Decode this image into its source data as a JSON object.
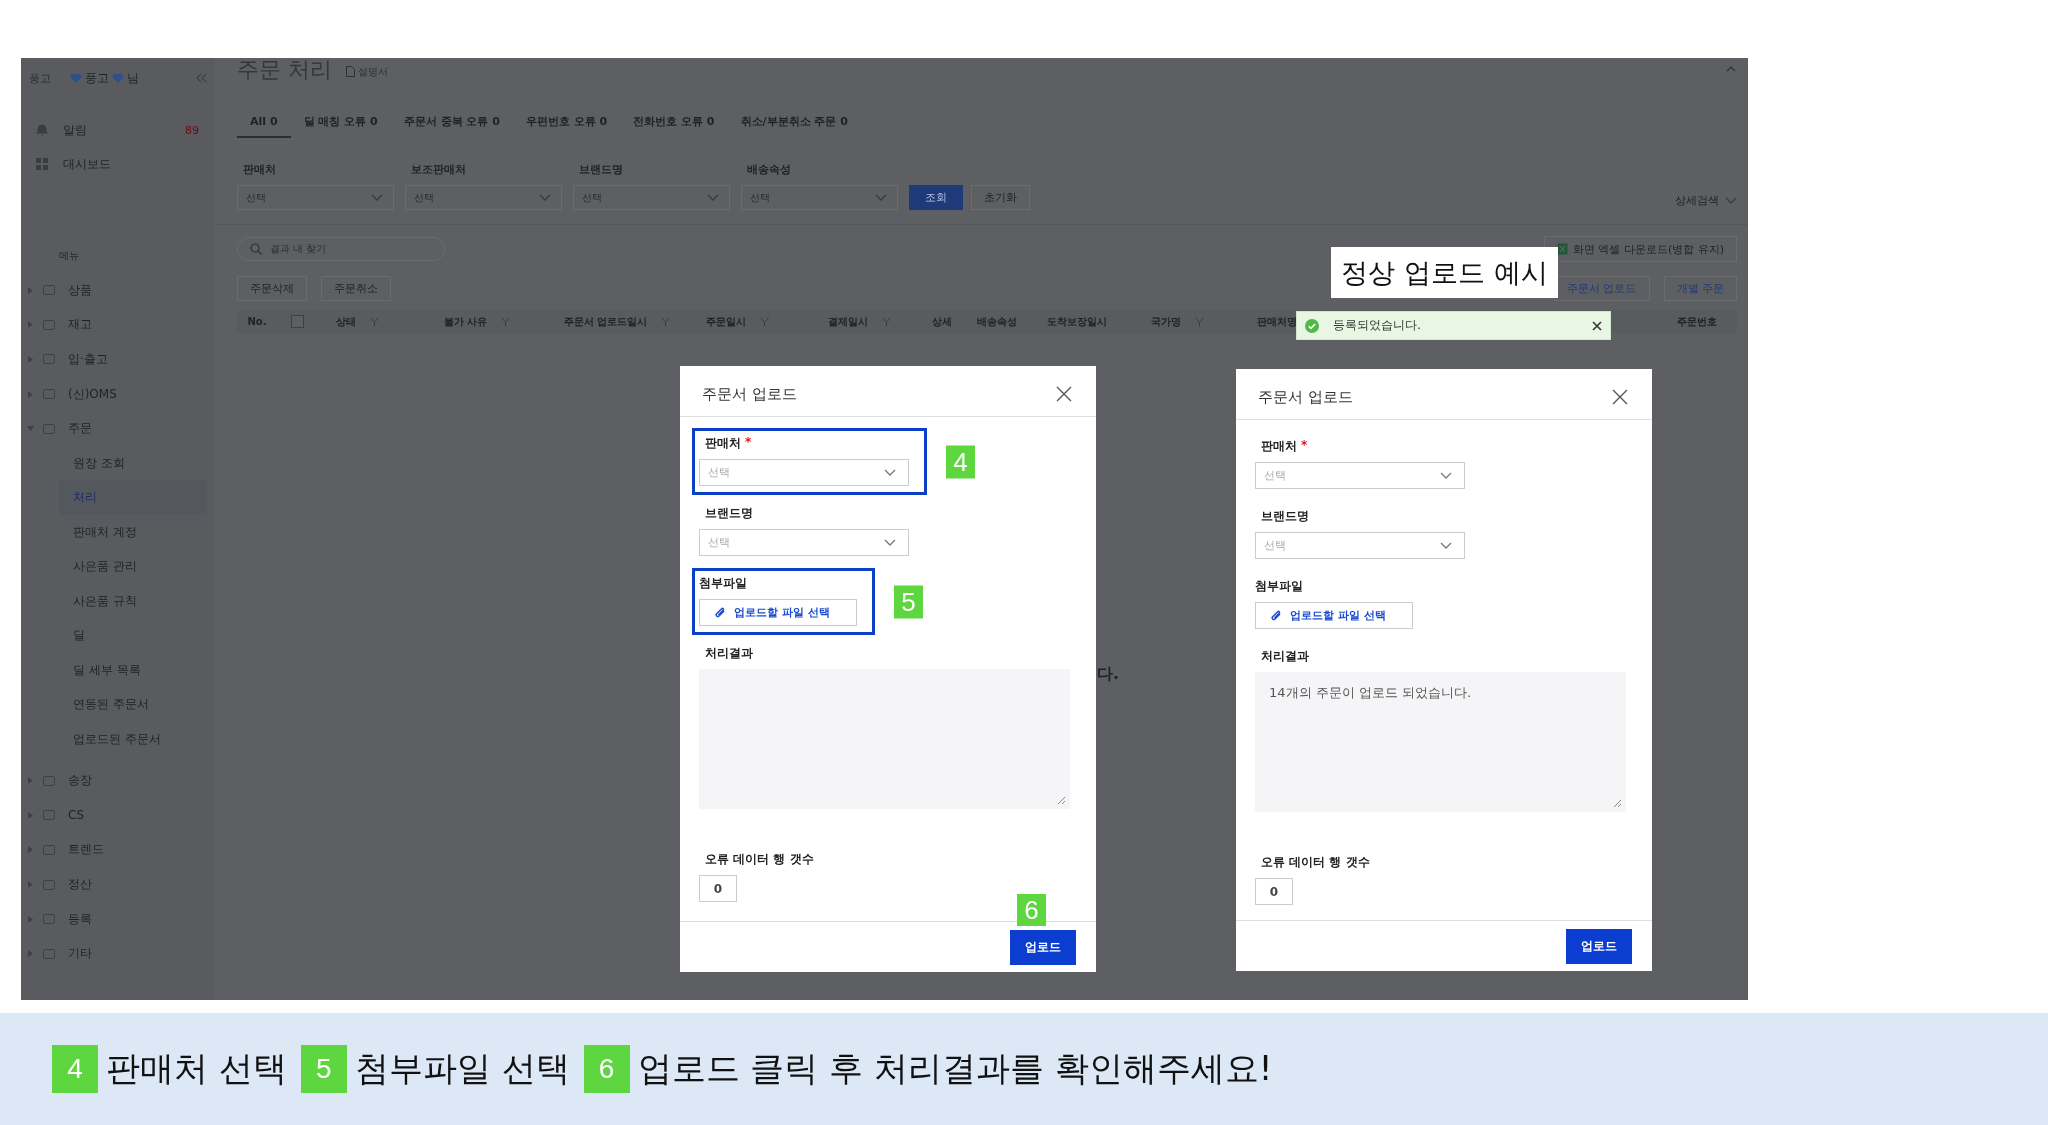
{
  "sidebar": {
    "logo": "풍고",
    "user": {
      "name": "풍고",
      "suffix": "님"
    },
    "top_items": [
      {
        "label": "알림",
        "count": "89"
      },
      {
        "label": "대시보드"
      }
    ],
    "section": "메뉴",
    "menu": [
      {
        "label": "상품",
        "expanded": false
      },
      {
        "label": "재고",
        "expanded": false
      },
      {
        "label": "입·출고",
        "expanded": false
      },
      {
        "label": "(신)OMS",
        "expanded": false
      },
      {
        "label": "주문",
        "expanded": true,
        "children": [
          {
            "label": "원장 조회",
            "selected": false
          },
          {
            "label": "처리",
            "selected": true
          },
          {
            "label": "판매처 계정",
            "selected": false
          },
          {
            "label": "사은품 관리",
            "selected": false
          },
          {
            "label": "사은품 규칙",
            "selected": false
          },
          {
            "label": "딜",
            "selected": false
          },
          {
            "label": "딜 세부 목록",
            "selected": false
          },
          {
            "label": "연동된 주문서",
            "selected": false
          },
          {
            "label": "업로드된 주문서",
            "selected": false
          }
        ]
      },
      {
        "label": "송장",
        "expanded": false
      },
      {
        "label": "CS",
        "expanded": false
      },
      {
        "label": "트렌드",
        "expanded": false
      },
      {
        "label": "정산",
        "expanded": false
      },
      {
        "label": "등록",
        "expanded": false
      },
      {
        "label": "기타",
        "expanded": false
      }
    ]
  },
  "page": {
    "title": "주문 처리",
    "manual_link": "설명서",
    "tabs": [
      {
        "label": "All 0",
        "selected": true
      },
      {
        "label": "딜 매칭 오류 0",
        "selected": false
      },
      {
        "label": "주문서 중복 오류 0",
        "selected": false
      },
      {
        "label": "우편번호 오류 0",
        "selected": false
      },
      {
        "label": "전화번호 오류 0",
        "selected": false
      },
      {
        "label": "취소/부분취소 주문 0",
        "selected": false
      }
    ],
    "filters": [
      {
        "label": "판매처",
        "placeholder": "선택"
      },
      {
        "label": "보조판매처",
        "placeholder": "선택"
      },
      {
        "label": "브랜드명",
        "placeholder": "선택"
      },
      {
        "label": "배송속성",
        "placeholder": "선택"
      }
    ],
    "search_button": "조회",
    "reset_button": "초기화",
    "detail_search": "상세검색",
    "search": {
      "placeholder": "결과 내 찾기"
    },
    "excel_button": "화면 엑셀 다운로드(병합 유지)",
    "action_buttons": [
      "주문삭제",
      "주문취소"
    ],
    "right_buttons": [
      "주문서 업로드",
      "개별 주문"
    ],
    "columns": [
      {
        "kind": "text",
        "label": "No.",
        "filter": false
      },
      {
        "kind": "checkbox",
        "checked": false
      },
      {
        "kind": "text",
        "label": "상태",
        "filter": true
      },
      {
        "kind": "text",
        "label": "불가 사유",
        "filter": true
      },
      {
        "kind": "text",
        "label": "주문서 업로드일시",
        "filter": true
      },
      {
        "kind": "text",
        "label": "주문일시",
        "filter": true
      },
      {
        "kind": "text",
        "label": "결제일시",
        "filter": true
      },
      {
        "kind": "text",
        "label": "상세",
        "filter": false
      },
      {
        "kind": "text",
        "label": "배송속성",
        "filter": false
      },
      {
        "kind": "text",
        "label": "도착보장일시",
        "filter": false
      },
      {
        "kind": "text",
        "label": "국가명",
        "filter": true
      },
      {
        "kind": "text",
        "label": "판매처명",
        "filter": false
      },
      {
        "kind": "text",
        "label": "주문번호",
        "filter": false
      }
    ],
    "empty_message": "다."
  },
  "toast": {
    "caption": "정상 업로드 예시",
    "message": "등록되었습니다."
  },
  "modals": [
    {
      "title": "주문서 업로드",
      "fields": [
        {
          "kind": "select",
          "label": "판매처",
          "required_mark": "*",
          "placeholder": "선택",
          "badge": "4"
        },
        {
          "kind": "select",
          "label": "브랜드명",
          "placeholder": "선택"
        },
        {
          "kind": "file",
          "label": "첨부파일",
          "button": "업로드할 파일 선택",
          "badge": "5"
        },
        {
          "kind": "textarea",
          "label": "처리결과"
        },
        {
          "kind": "number",
          "label": "오류 데이터 행 갯수",
          "value": "0"
        }
      ],
      "submit": {
        "label": "업로드",
        "badge": "6"
      }
    },
    {
      "title": "주문서 업로드",
      "fields": [
        {
          "kind": "select",
          "label": "판매처",
          "required_mark": "*",
          "placeholder": "선택"
        },
        {
          "kind": "select",
          "label": "브랜드명",
          "placeholder": "선택"
        },
        {
          "kind": "file",
          "label": "첨부파일",
          "button": "업로드할 파일 선택"
        },
        {
          "kind": "textarea",
          "label": "처리결과",
          "value": "14개의 주문이 업로드 되었습니다."
        },
        {
          "kind": "number",
          "label": "오류 데이터 행 갯수",
          "value": "0"
        }
      ],
      "submit": {
        "label": "업로드"
      }
    }
  ],
  "instructions": [
    {
      "badge": "4",
      "text": "판매처 선택"
    },
    {
      "badge": "5",
      "text": "첨부파일 선택"
    },
    {
      "badge": "6",
      "text": "업로드 클릭 후 처리결과를 확인해주세요!"
    }
  ]
}
